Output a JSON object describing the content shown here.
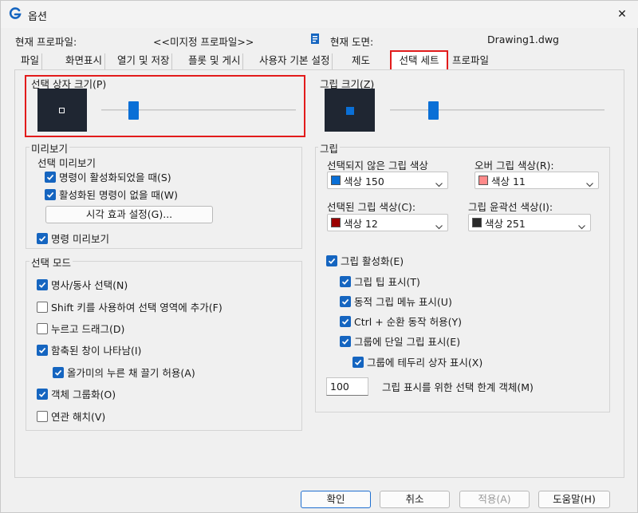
{
  "window": {
    "title": "옵션",
    "close_glyph": "✕"
  },
  "header": {
    "current_profile_label": "현재 프로파일:",
    "current_profile_value": "<<미지정 프로파일>>",
    "current_drawing_label": "현재 도면:",
    "current_drawing_value": "Drawing1.dwg"
  },
  "tabs": [
    "파일",
    "화면표시",
    "열기 및 저장",
    "플롯 및 게시",
    "사용자 기본 설정",
    "제도",
    "선택 세트",
    "프로파일"
  ],
  "active_tab": "선택 세트",
  "pickbox": {
    "title": "선택 상자 크기(P)",
    "slider_level": 0.27
  },
  "grip_size": {
    "title": "그립 크기(Z)",
    "slider_level": 0.27
  },
  "preview": {
    "title": "미리보기",
    "sub_title": "선택 미리보기",
    "items": [
      {
        "label": "명령이 활성화되었을 때(S)",
        "checked": true
      },
      {
        "label": "활성화된 명령이 없을 때(W)",
        "checked": true
      }
    ],
    "visual_button": "시각 효과 설정(G)...",
    "command_preview": {
      "label": "명령 미리보기",
      "checked": true
    }
  },
  "selection_mode": {
    "title": "선택 모드",
    "items": [
      {
        "label": "명사/동사 선택(N)",
        "checked": true
      },
      {
        "label": "Shift 키를 사용하여 선택 영역에 추가(F)",
        "checked": false
      },
      {
        "label": "누르고 드래그(D)",
        "checked": false
      },
      {
        "label": "함축된 창이 나타남(I)",
        "checked": true
      },
      {
        "label": "올가미의 누른 채 끌기 허용(A)",
        "checked": true
      },
      {
        "label": "객체 그룹화(O)",
        "checked": true
      },
      {
        "label": "연관 해치(V)",
        "checked": false
      }
    ]
  },
  "grips": {
    "title": "그립",
    "unselected_label": "선택되지 않은 그립 색상",
    "unselected_value": "색상 150",
    "unselected_color": "#0a6fd6",
    "hover_label": "오버 그립 색상(R):",
    "hover_value": "색상 11",
    "hover_color": "#ff8a8a",
    "selected_label": "선택된 그립 색상(C):",
    "selected_value": "색상 12",
    "selected_color": "#9b0000",
    "contour_label": "그립 윤곽선 색상(I):",
    "contour_value": "색상 251",
    "contour_color": "#2a2a2a",
    "checks": [
      {
        "label": "그립 활성화(E)",
        "checked": true
      },
      {
        "label": "그립 팁 표시(T)",
        "checked": true
      },
      {
        "label": "동적 그립 메뉴 표시(U)",
        "checked": true
      },
      {
        "label": "Ctrl + 순환 동작 허용(Y)",
        "checked": true
      },
      {
        "label": "그룹에 단일 그립 표시(E)",
        "checked": true
      },
      {
        "label": "그룹에 테두리 상자 표시(X)",
        "checked": true
      }
    ],
    "limit_value": "100",
    "limit_label": "그립 표시를 위한 선택 한계 객체(M)"
  },
  "buttons": {
    "ok": "확인",
    "cancel": "취소",
    "apply": "적용(A)",
    "help": "도움말(H)"
  },
  "colors": {
    "accent": "#1565c0",
    "highlight_red": "#e21b1b"
  }
}
